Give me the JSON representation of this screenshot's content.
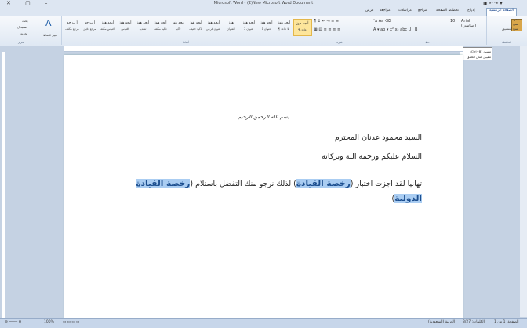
{
  "window": {
    "title": "Microsoft Word - (2)New Microsoft Word Document",
    "controls": "✕ ▢ –"
  },
  "tabs": [
    {
      "label": "الصفحة الرئيسية",
      "active": true
    },
    {
      "label": "إدراج"
    },
    {
      "label": "تخطيط الصفحة"
    },
    {
      "label": "مراجع"
    },
    {
      "label": "مراسلات"
    },
    {
      "label": "مراجعة"
    },
    {
      "label": "عرض"
    }
  ],
  "clipboard": {
    "paste": "لصق",
    "cut": "قص",
    "copy": "نسخ",
    "painter": "نسخ التنسيق"
  },
  "font": {
    "name": "Arial (أساسي)",
    "size": "10"
  },
  "styles": [
    {
      "label": "¶ عادي",
      "sample": "أبجد هوز",
      "active": true
    },
    {
      "label": "¶ بلا تباعد",
      "sample": "أبجد هوز"
    },
    {
      "label": "عنوان 1",
      "sample": "أبجد هوز"
    },
    {
      "label": "عنوان 2",
      "sample": "أبجد هوز"
    },
    {
      "label": "العنوان",
      "sample": "هوز"
    },
    {
      "label": "عنوان فرعي",
      "sample": "أبجد هوز"
    },
    {
      "label": "تأكيد خفيف",
      "sample": "أبجد هوز"
    },
    {
      "label": "تأكيد",
      "sample": "أبجد هوز"
    },
    {
      "label": "تأكيد مكثف",
      "sample": "أبجد هوز"
    },
    {
      "label": "تشديد",
      "sample": "أبجد هوز"
    },
    {
      "label": "اقتباس",
      "sample": "أبجد هوز"
    },
    {
      "label": "اقتباس مكثف",
      "sample": "أبجد هوز"
    },
    {
      "label": "مرجع دقيق",
      "sample": "أ ب جد"
    },
    {
      "label": "مرجع مكثف",
      "sample": "أ ب جد"
    }
  ],
  "groups": {
    "clipboard": "الحافظة",
    "font": "خط",
    "paragraph": "فقرة",
    "styles": "أنماط",
    "editing": "تحرير"
  },
  "editing": {
    "find": "بحث",
    "replace": "استبدال",
    "select": "تحديد",
    "change_styles": "تغيير الأنماط"
  },
  "tooltip": {
    "line1": "تنسيق (Ctrl+B)",
    "line2": "تطبيق النص الغامق"
  },
  "document": {
    "bismillah": "بسم الله الرحمن الرحيم",
    "line1": "السيد محمود عدنان المحترم",
    "line2": "السلام عليكم ورحمه الله وبركاته",
    "line3_a": "تهانيا لقد اجزت اختبار (",
    "line3_hl1": "رخصة القيادة",
    "line3_b": ") لذلك نرجو منك التفضل باستلام (",
    "line3_hl2": "رخصة القيادة الدولية",
    "line3_c": ")"
  },
  "status": {
    "page": "الصفحة: 1 من 1",
    "words": "الكلمات: 3/27",
    "lang": "العربية (السعودية)",
    "zoom": "100%"
  },
  "colors": {
    "highlight": "#aacdf2",
    "ribbon": "#dfe8f3",
    "accent": "#15428b"
  }
}
